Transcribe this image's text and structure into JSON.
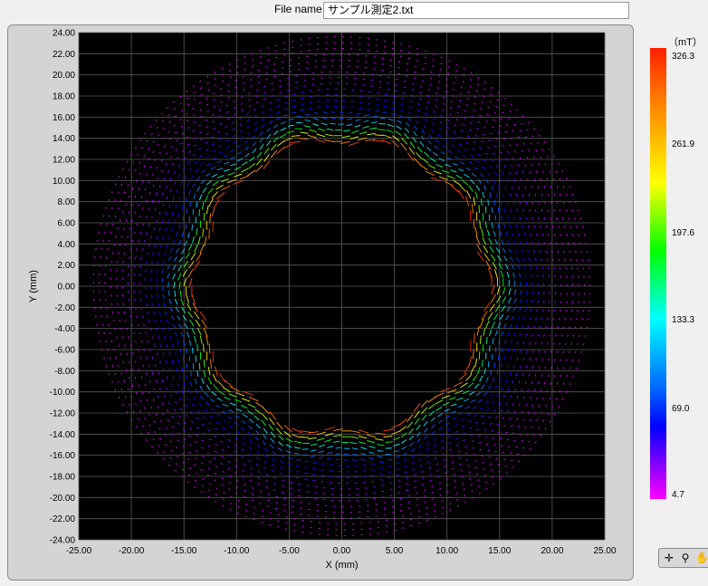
{
  "header": {
    "file_label": "File name",
    "file_value": "サンプル測定2.txt"
  },
  "colorbar": {
    "unit": "（mT）",
    "ticks": [
      "326.3",
      "261.9",
      "197.6",
      "133.3",
      "69.0",
      "4.7"
    ]
  },
  "toolbar": {
    "icons": [
      "crosshair-icon",
      "zoom-icon",
      "pan-icon"
    ]
  },
  "chart_data": {
    "type": "scatter",
    "title": "",
    "xlabel": "X (mm)",
    "ylabel": "Y (mm)",
    "xlim": [
      -25,
      25
    ],
    "ylim": [
      -24,
      24
    ],
    "x_ticks": [
      "-25.00",
      "-20.00",
      "-15.00",
      "-10.00",
      "-5.00",
      "0.00",
      "5.00",
      "10.00",
      "15.00",
      "20.00",
      "25.00"
    ],
    "y_ticks": [
      "24.00",
      "22.00",
      "20.00",
      "18.00",
      "16.00",
      "14.00",
      "12.00",
      "10.00",
      "8.00",
      "6.00",
      "4.00",
      "2.00",
      "0.00",
      "-2.00",
      "-4.00",
      "-6.00",
      "-8.00",
      "-10.00",
      "-12.00",
      "-14.00",
      "-16.00",
      "-18.00",
      "-20.00",
      "-22.00",
      "-24.00"
    ],
    "grid": true,
    "background": "#000000",
    "color_scale": {
      "min": 4.7,
      "max": 326.3,
      "unit": "mT",
      "colors": [
        "#ff00ff",
        "#8000ff",
        "#0000ff",
        "#0060ff",
        "#00ffff",
        "#00ff00",
        "#ffff00",
        "#ff8000",
        "#ff2000"
      ]
    },
    "field_ring": {
      "inner_radius_mm": 13.7,
      "outer_radius_mm": 24,
      "lobes": 10
    }
  }
}
